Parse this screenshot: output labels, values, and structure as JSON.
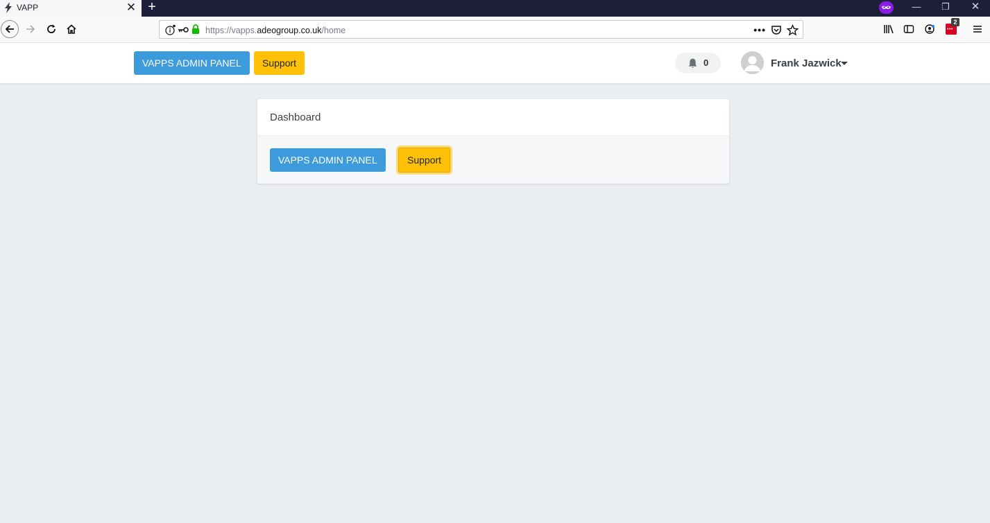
{
  "browser": {
    "tab": {
      "title": "VAPP"
    },
    "url": {
      "prefix": "https://vapps.",
      "host": "adeogroup.co.uk",
      "path": "/home"
    },
    "extension_badge": "2"
  },
  "header": {
    "admin_button": "VAPPS ADMIN PANEL",
    "support_button": "Support",
    "notifications_count": "0",
    "user_name": "Frank Jazwick"
  },
  "dashboard": {
    "title": "Dashboard",
    "admin_button": "VAPPS ADMIN PANEL",
    "support_button": "Support"
  },
  "colors": {
    "primary": "#3d9bdb",
    "warning": "#ffc107",
    "page_bg": "#ebeef1"
  }
}
